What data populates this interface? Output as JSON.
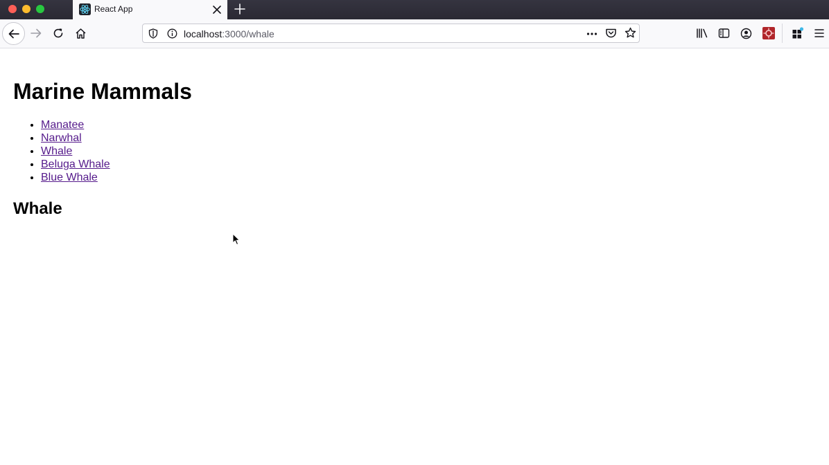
{
  "browser": {
    "tab_title": "React App",
    "url_host": "localhost",
    "url_path": ":3000/whale",
    "icons": {
      "favicon": "react-logo-icon",
      "tab_close": "close-icon",
      "new_tab": "plus-icon",
      "back": "back-arrow-icon",
      "forward": "forward-arrow-icon",
      "reload": "reload-icon",
      "home": "home-icon",
      "tracking": "shield-icon",
      "site_info": "info-icon",
      "page_actions": "more-horizontal-icon",
      "pocket": "pocket-icon",
      "bookmark": "star-icon",
      "library": "library-icon",
      "sidebar": "sidebar-icon",
      "account": "account-icon",
      "extension": "extension-icon",
      "extensions_menu": "puzzle-icon",
      "app_menu": "hamburger-menu-icon"
    }
  },
  "page": {
    "title": "Marine Mammals",
    "links": [
      {
        "label": "Manatee"
      },
      {
        "label": "Narwhal"
      },
      {
        "label": "Whale"
      },
      {
        "label": "Beluga Whale"
      },
      {
        "label": "Blue Whale"
      }
    ],
    "section_title": "Whale"
  },
  "colors": {
    "link_visited": "#551a8b",
    "tab_strip": "#2b2a33",
    "toolbar": "#f9f9fb"
  }
}
